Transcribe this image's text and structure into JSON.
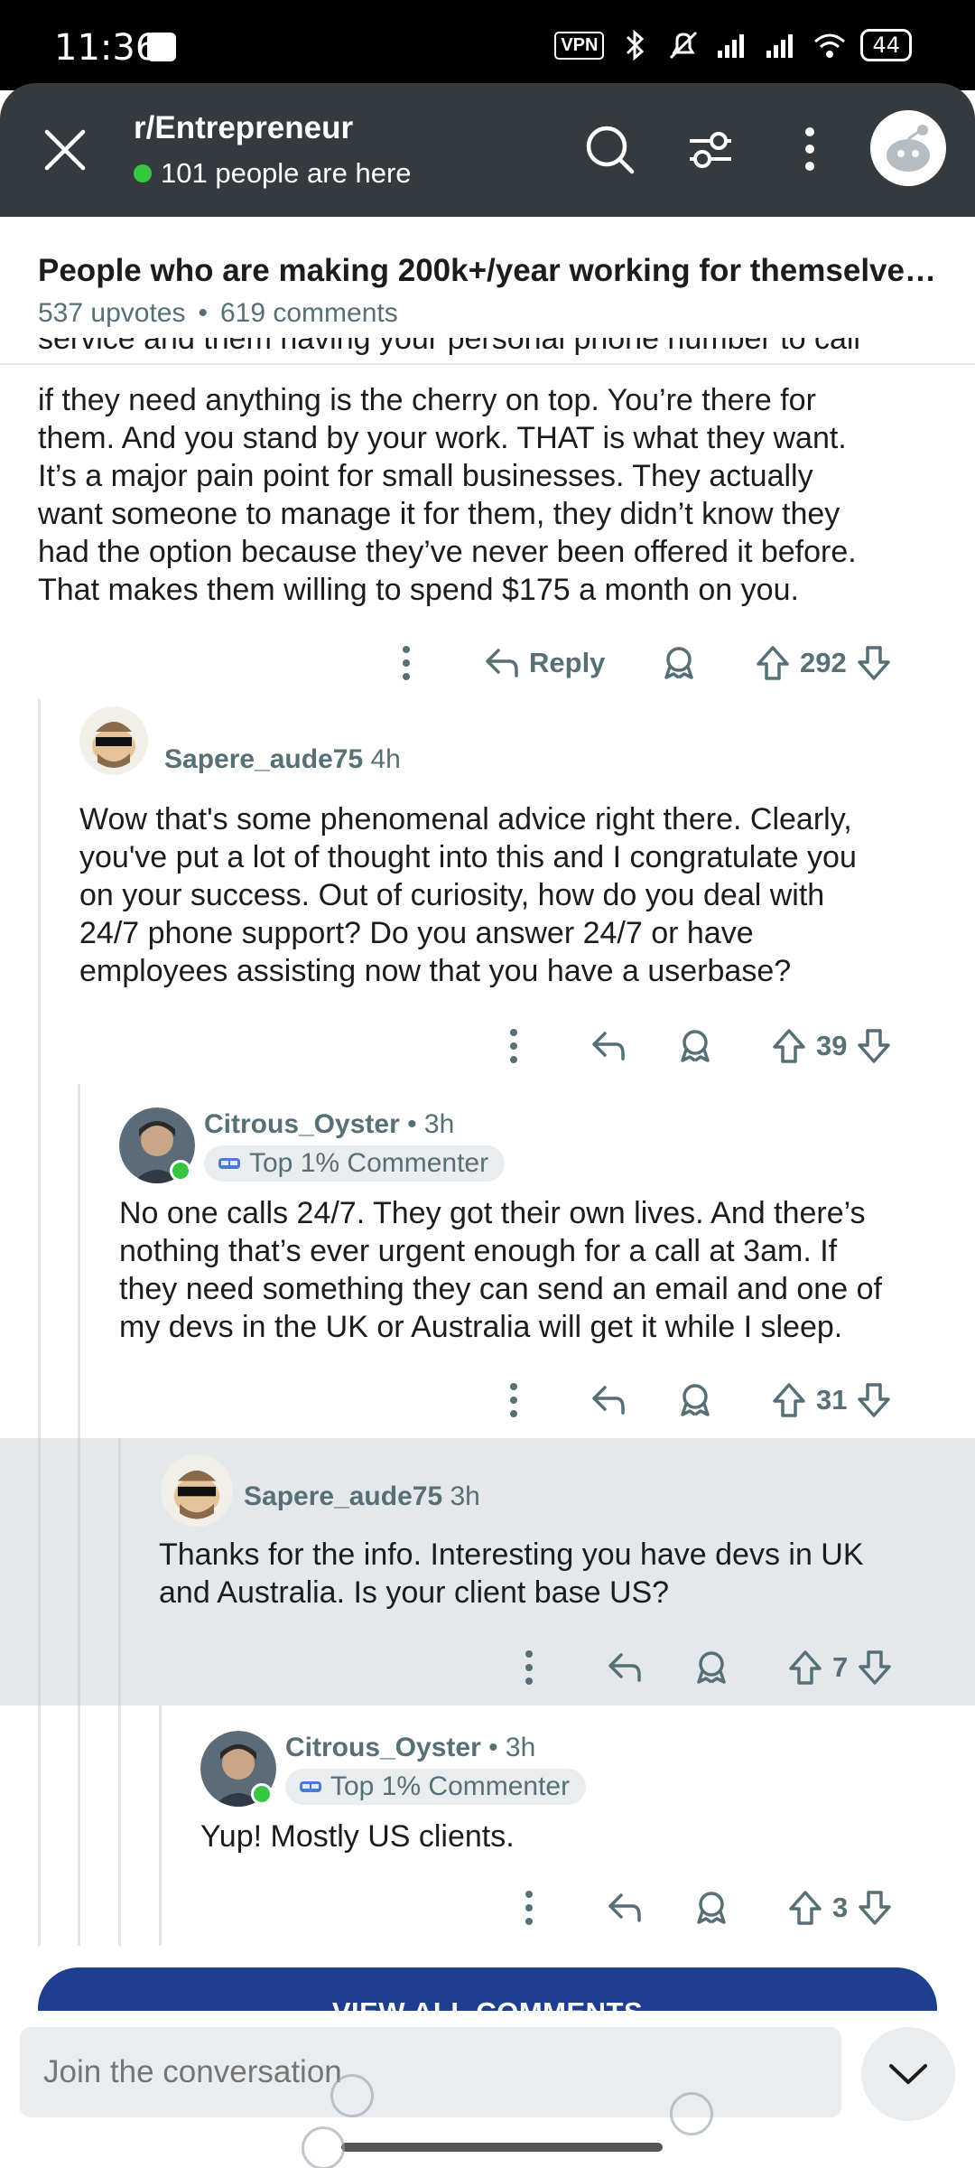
{
  "status_bar": {
    "time": "11:36",
    "vpn": "VPN",
    "battery": "44"
  },
  "header": {
    "subreddit": "r/Entrepreneur",
    "online": "101 people are here"
  },
  "post": {
    "title": "People who are making 200k+/year working for themselves,...",
    "upvotes": "537 upvotes",
    "separator": "•",
    "comments": "619 comments"
  },
  "comment1": {
    "cut_text": "service and them having your personal phone number to call",
    "text": "if they need anything is the cherry on top. You’re there for\nthem. And you stand by your work. THAT is what they want.\nIt’s a major pain point for small businesses. They actually\nwant someone to manage it for them, they didn’t know they\nhad the option because they’ve never been offered it before.\nThat makes them willing to spend $175 a month on you.",
    "reply_label": "Reply",
    "votes": "292"
  },
  "comment2": {
    "user": "Sapere_aude75",
    "age": "4h",
    "text": "Wow that's some phenomenal advice right there. Clearly,\nyou've put a lot of thought into this and I congratulate you\non your success. Out of curiosity, how do you deal with\n24/7 phone support? Do you answer 24/7 or have\nemployees assisting now that you have a userbase?",
    "votes": "39"
  },
  "comment3": {
    "user": "Citrous_Oyster",
    "age": "• 3h",
    "flair": "Top 1% Commenter",
    "text": "No one calls 24/7. They got their own lives. And there’s\nnothing that’s ever urgent enough for a call at 3am. If\nthey need something they can send an email and one of\nmy devs in the UK or Australia will get it while I sleep.",
    "votes": "31"
  },
  "comment4": {
    "user": "Sapere_aude75",
    "age": "3h",
    "text": "Thanks for the info. Interesting you have devs in UK\nand Australia. Is your client base US?",
    "votes": "7"
  },
  "comment5": {
    "user": "Citrous_Oyster",
    "age": "• 3h",
    "flair": "Top 1% Commenter",
    "text": "Yup! Mostly US clients.",
    "votes": "3"
  },
  "view_all": "VIEW ALL COMMENTS",
  "composer": {
    "placeholder": "Join the conversation"
  },
  "colors": {
    "header_bg": "#353a3e",
    "accent_blue": "#1e3e8f",
    "online_green": "#36c73e",
    "meta_gray": "#576f76"
  }
}
